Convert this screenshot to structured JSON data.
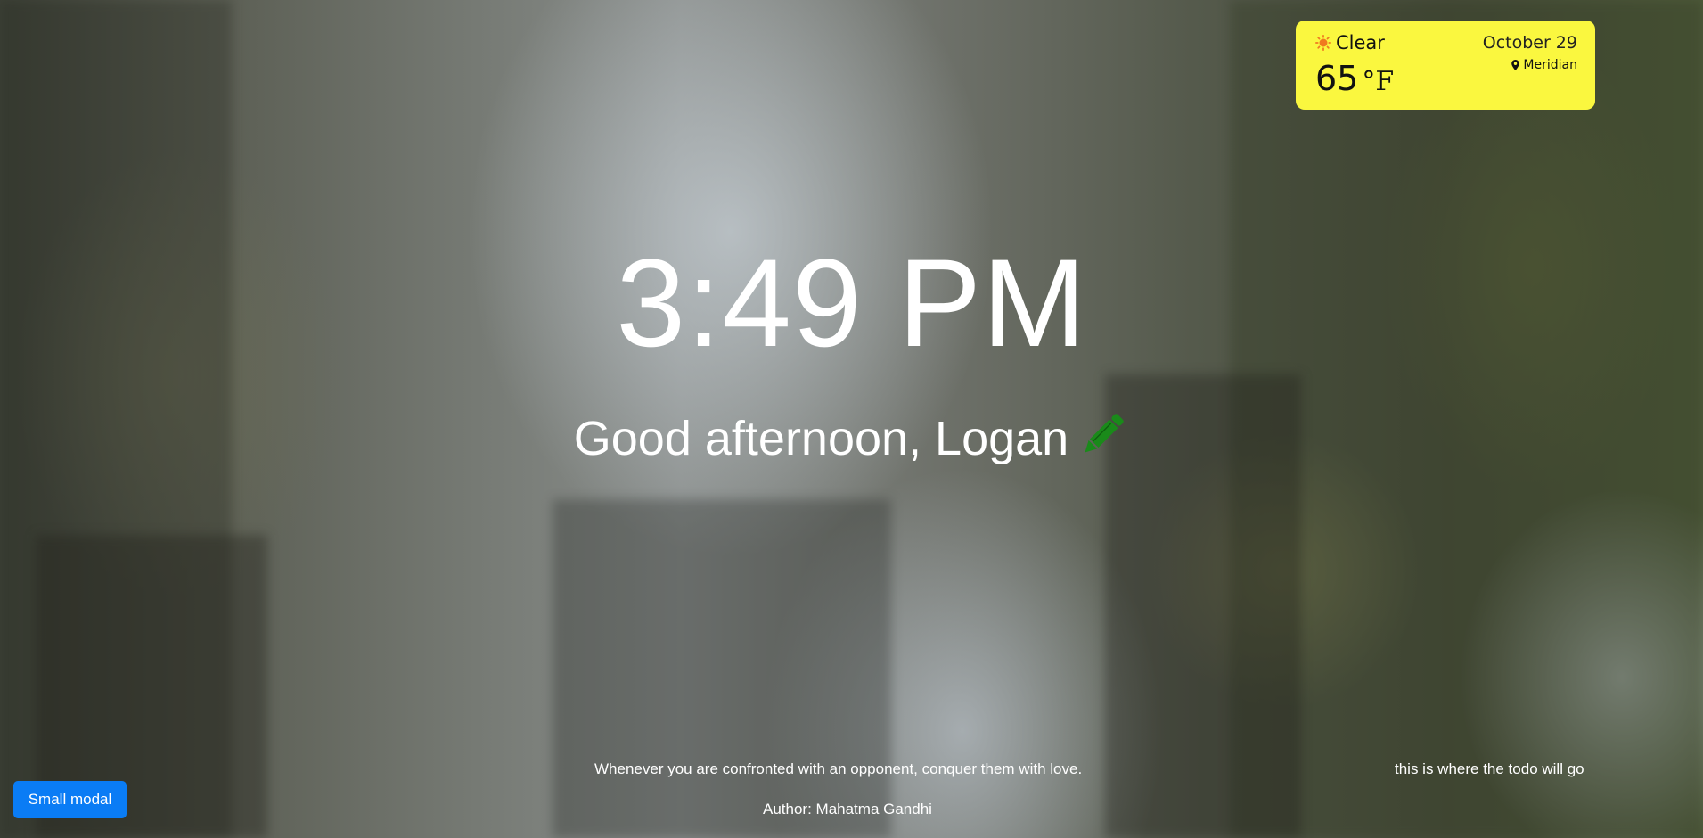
{
  "clock": {
    "time": "3:49 PM"
  },
  "greeting": {
    "text": "Good afternoon, Logan",
    "edit_icon": "pencil-icon",
    "edit_icon_color": "#1a8a1a"
  },
  "weather": {
    "condition": "Clear",
    "condition_icon": "sun-icon",
    "date": "October 29",
    "temperature": "65",
    "unit": "°F",
    "location_icon": "map-pin-icon",
    "location": "Meridian",
    "card_color": "#faf73f"
  },
  "quote": {
    "text": "Whenever you are confronted with an opponent, conquer them with love.",
    "author": "Author: Mahatma Gandhi"
  },
  "todo": {
    "placeholder_text": "this is where the todo will go"
  },
  "modal_button": {
    "label": "Small modal",
    "color": "#0a7cf5"
  }
}
